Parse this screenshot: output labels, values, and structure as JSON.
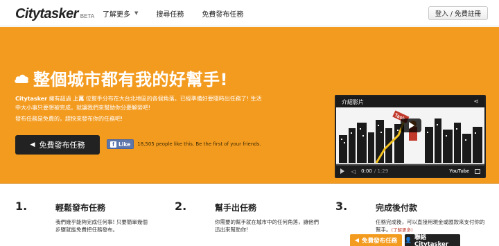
{
  "nav": {
    "logo_main": "Citytasker",
    "logo_beta": "BETA",
    "links": [
      "了解更多",
      "搜尋任務",
      "免費發布任務"
    ],
    "login": "登入 / 免費註冊"
  },
  "hero": {
    "title": "整個城市都有我的好幫手!",
    "desc_brand": "Citytasker",
    "desc_text_1": " 擁有超過 ",
    "desc_count": "上萬",
    "desc_text_2": " 位幫手分布在大台北地區的各個角落，已經準備好要隨時出任務了! 生活中大小事只要想被完成，就讓我們來幫助你分憂解勞吧!",
    "free_line": "發布任務是免費的，趕快來發布你的任務吧!",
    "post_button": "免費發布任務",
    "fb_like": "Like",
    "fb_text": "18,505 people like this. Be the first of your friends."
  },
  "video": {
    "title": "介紹影片",
    "time_current": "0:00",
    "time_total": "/ 1:29",
    "youtube": "YouTube",
    "sign": "Task",
    "progress": 0
  },
  "steps": [
    {
      "num": "1.",
      "title": "輕鬆發布任務",
      "desc": "我們幾乎能夠完成任何事! 只要簡單幾個步驟就能免費把任務發布。"
    },
    {
      "num": "2.",
      "title": "幫手出任務",
      "desc": "你需要的幫手就在城市中的任何角落，讓他們迅出來幫助你!"
    },
    {
      "num": "3.",
      "title": "完成後付款",
      "desc": "任務完成後，可以直接用現金或匯款來支付你的幫手。",
      "more": "(了解更多)"
    }
  ],
  "footer": {
    "post": "免費發布任務",
    "contact": "聯絡 Citytasker"
  },
  "colors": {
    "brand_orange": "#f39b1f",
    "dark": "#222222"
  }
}
